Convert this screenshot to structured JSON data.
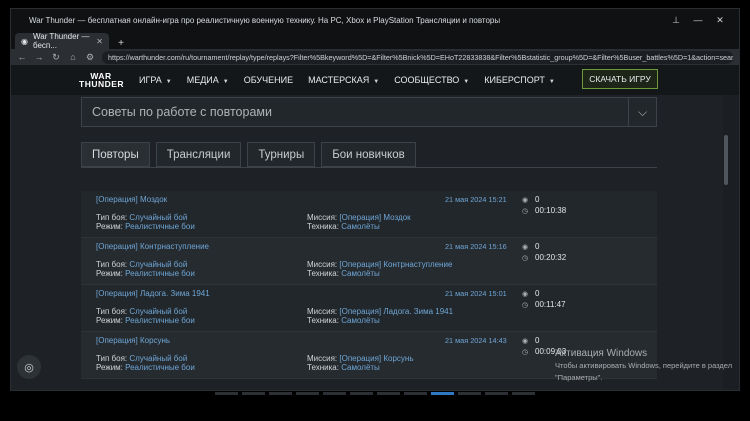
{
  "window": {
    "title": "War Thunder — бесплатная онлайн-игра про реалистичную военную технику. На PC, Xbox и PlayStation Трансляции и повторы"
  },
  "browser": {
    "tab_label": "War Thunder — бесп...",
    "url": "https://warthunder.com/ru/tournament/replay/type/replays?Filter%5Bkeyword%5D=&Filter%5Bnick%5D=EHoT22833838&Filter%5Bstatistic_group%5D=&Filter%5Buser_battles%5D=1&action=search"
  },
  "site": {
    "logo_line1": "WAR",
    "logo_line2": "THUNDER",
    "menu": [
      "ИГРА",
      "МЕДИА",
      "ОБУЧЕНИЕ",
      "МАСТЕРСКАЯ",
      "СООБЩЕСТВО",
      "КИБЕРСПОРТ"
    ],
    "download_label": "СКАЧАТЬ ИГРУ"
  },
  "filter": {
    "select_value": "Советы по работе с повторами"
  },
  "tabs": [
    "Повторы",
    "Трансляции",
    "Турниры",
    "Бои новичков"
  ],
  "labels": {
    "battle_type": "Тип боя:",
    "mode": "Режим:",
    "mission": "Миссия:",
    "vehicle": "Техника:"
  },
  "replays": [
    {
      "name": "[Операция] Моздок",
      "date": "21 мая 2024 15:21",
      "battle_type": "Случайный бой",
      "mode": "Реалистичные бои",
      "mission": "[Операция] Моздок",
      "vehicle": "Самолёты",
      "views": "0",
      "duration": "00:10:38"
    },
    {
      "name": "[Операция] Контрнаступление",
      "date": "21 мая 2024 15:16",
      "battle_type": "Случайный бой",
      "mode": "Реалистичные бои",
      "mission": "[Операция] Контрнаступление",
      "vehicle": "Самолёты",
      "views": "0",
      "duration": "00:20:32"
    },
    {
      "name": "[Операция] Ладога. Зима 1941",
      "date": "21 мая 2024 15:01",
      "battle_type": "Случайный бой",
      "mode": "Реалистичные бои",
      "mission": "[Операция] Ладога. Зима 1941",
      "vehicle": "Самолёты",
      "views": "0",
      "duration": "00:11:47"
    },
    {
      "name": "[Операция] Корсунь",
      "date": "21 мая 2024 14:43",
      "battle_type": "Случайный бой",
      "mode": "Реалистичные бои",
      "mission": "[Операция] Корсунь",
      "vehicle": "Самолёты",
      "views": "0",
      "duration": "00:09:03"
    }
  ],
  "watermark": {
    "line1": "Активация Windows",
    "line2": "Чтобы активировать Windows, перейдите в раздел",
    "line3": "\"Параметры\"."
  },
  "colors": {
    "accent": "#6fa6d6",
    "download_border": "#6c9a3b",
    "pager_active": "#2f78c4"
  }
}
